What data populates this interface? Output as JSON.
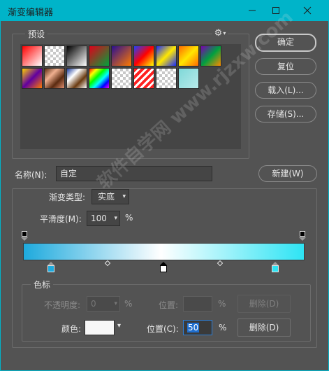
{
  "window": {
    "title": "渐变编辑器"
  },
  "presets": {
    "label": "预设",
    "gear_glyph": "⚙",
    "swatches": [
      {
        "name": "red-transparent",
        "css": "linear-gradient(135deg,#ff0000,#ffffff)"
      },
      {
        "name": "red-check",
        "css": "linear-gradient(135deg,rgba(255,0,0,1),rgba(255,0,0,0))",
        "checker": true
      },
      {
        "name": "black-white",
        "css": "linear-gradient(135deg,#000000,#ffffff)"
      },
      {
        "name": "red-green",
        "css": "linear-gradient(135deg,#e0001a,#00a23a)"
      },
      {
        "name": "violet-orange",
        "css": "linear-gradient(135deg,#2a1090,#ff7a00)"
      },
      {
        "name": "blue-red-yellow",
        "css": "linear-gradient(135deg,#2040ff,#ff0000,#ffff00)"
      },
      {
        "name": "blue-yellow-blue",
        "css": "linear-gradient(135deg,#1a2cff,#ffe800,#1a2cff)"
      },
      {
        "name": "orange-yellow",
        "css": "linear-gradient(135deg,#ff6a00,#ffe600,#ff6a00)"
      },
      {
        "name": "violet-green-orange",
        "css": "linear-gradient(135deg,#7a00b0,#00a040,#ff8a00)"
      },
      {
        "name": "yellow-violet-orange",
        "css": "linear-gradient(135deg,#ffd000,#6000a0,#ff7a00)"
      },
      {
        "name": "copper",
        "css": "linear-gradient(135deg,#5a2a10,#f0b090,#5a2a10,#e09070)"
      },
      {
        "name": "chrome",
        "css": "linear-gradient(135deg,#1a3a9a,#ffffff,#6a3a10,#ffffff)"
      },
      {
        "name": "spectrum",
        "css": "linear-gradient(135deg,#ff0000,#ffff00,#00ff00,#00ffff,#0000ff,#ff00ff)"
      },
      {
        "name": "transparent-rainbow",
        "css": "linear-gradient(135deg,#ff00ff,#00ffff,#ffff00,#00ff00)",
        "checker": true
      },
      {
        "name": "transparent-stripes",
        "css": "repeating-linear-gradient(135deg,#ff2020 0 4px,#ffffff 4px 7px)"
      },
      {
        "name": "transparent-checker",
        "css": "none",
        "checker": true
      },
      {
        "name": "cyan-solid",
        "css": "linear-gradient(135deg,#7fd8d8,#b8eaea)"
      }
    ]
  },
  "buttons": {
    "ok": "确定",
    "reset": "复位",
    "load": "载入(L)...",
    "save": "存储(S)...",
    "new": "新建(W)"
  },
  "name_row": {
    "label": "名称(N):",
    "value": "自定"
  },
  "gradient": {
    "type_label": "渐变类型:",
    "type_value": "实底",
    "smooth_label": "平滑度(M):",
    "smooth_value": "100",
    "smooth_unit": "%",
    "colors": {
      "left": "#1eaadd",
      "mid": "#ffffff",
      "right": "#2ee4f4"
    }
  },
  "stops": {
    "legend": "色标",
    "opacity_label": "不透明度:",
    "opacity_value": "0",
    "opacity_unit": "%",
    "opacity_location_label": "位置:",
    "opacity_location_unit": "%",
    "opacity_delete": "删除(D)",
    "color_label": "颜色:",
    "color_value": "#f7f7f7",
    "location_label": "位置(C):",
    "location_value": "50",
    "location_unit": "%",
    "delete": "删除(D)"
  },
  "watermark": "软件自学网 www.rjzxw.com"
}
